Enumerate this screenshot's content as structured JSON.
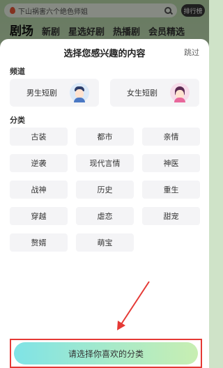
{
  "search": {
    "text": "下山祸害六个绝色师姐",
    "rank_label": "排行榜"
  },
  "top_tabs": [
    "剧场",
    "新剧",
    "星选好剧",
    "热播剧",
    "会员精选"
  ],
  "modal": {
    "title": "选择您感兴趣的内容",
    "skip_label": "跳过",
    "channel_section": "频道",
    "channels": [
      {
        "label": "男生短剧",
        "avatar": "male-avatar-icon"
      },
      {
        "label": "女生短剧",
        "avatar": "female-avatar-icon"
      }
    ],
    "category_section": "分类",
    "categories": [
      "古装",
      "都市",
      "亲情",
      "逆袭",
      "现代言情",
      "神医",
      "战神",
      "历史",
      "重生",
      "穿越",
      "虐恋",
      "甜宠",
      "赘婿",
      "萌宝"
    ],
    "cta_label": "请选择你喜欢的分类"
  },
  "colors": {
    "highlight": "#e53935",
    "cta_gradient_start": "#7fe3e6",
    "cta_gradient_end": "#c8eeb2"
  }
}
